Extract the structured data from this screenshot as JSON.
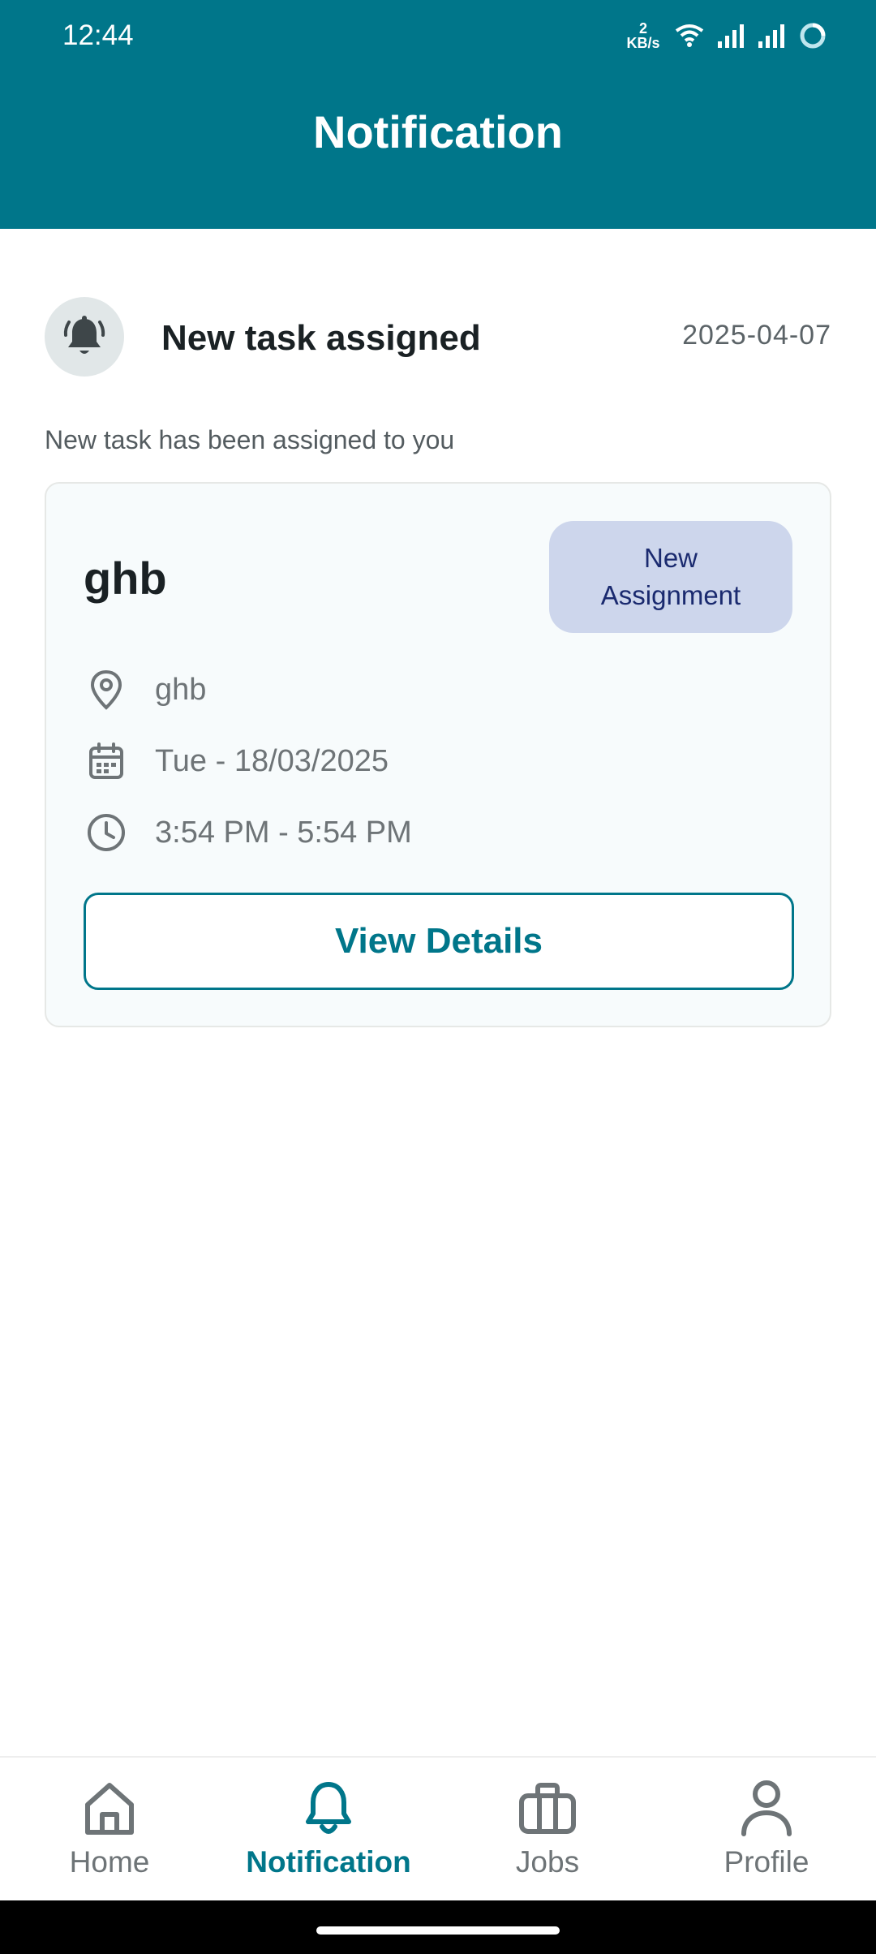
{
  "status_bar": {
    "time": "12:44",
    "speed_value": "2",
    "speed_unit": "KB/s"
  },
  "header": {
    "title": "Notification"
  },
  "notification": {
    "icon": "bell-ring-icon",
    "title": "New task assigned",
    "date": "2025-04-07",
    "description": "New task has been assigned to you"
  },
  "task_card": {
    "title": "ghb",
    "badge_line1": "New",
    "badge_line2": "Assignment",
    "location": "ghb",
    "date": "Tue - 18/03/2025",
    "time": "3:54 PM - 5:54 PM",
    "button_label": "View Details"
  },
  "bottom_nav": {
    "items": [
      {
        "label": "Home",
        "icon": "home-icon"
      },
      {
        "label": "Notification",
        "icon": "bell-icon",
        "active": true
      },
      {
        "label": "Jobs",
        "icon": "briefcase-icon"
      },
      {
        "label": "Profile",
        "icon": "user-icon"
      }
    ]
  },
  "colors": {
    "primary": "#00768a",
    "badge_bg": "#cdd6ec",
    "badge_text": "#1a2a6f",
    "muted_text": "#6e7477"
  }
}
